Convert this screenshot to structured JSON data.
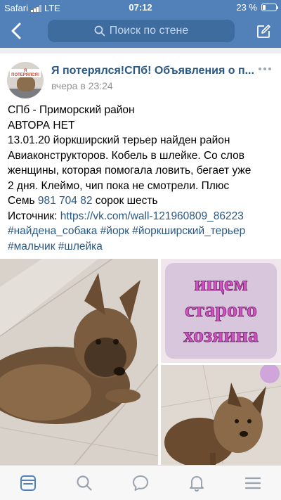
{
  "status_bar": {
    "carrier": "Safari",
    "network": "LTE",
    "time": "07:12",
    "battery": "23 %",
    "battery_level": 0.23
  },
  "navbar": {
    "search_placeholder": "Поиск по стене",
    "back_icon": "chevron-left-icon",
    "compose_icon": "compose-icon"
  },
  "post": {
    "group_name": "Я потерялся!СПб! Объявления о п...",
    "avatar_label": "Я ПОТЕРЯЛСЯ!",
    "time": "вчера в 23:24",
    "lines": {
      "l1": "СПб - Приморский район",
      "l2": "АВТОРА НЕТ",
      "l3": "13.01.20 йоркширский терьер найден район",
      "l4": "Авиаконструкторов. Кобель в шлейке. Со слов",
      "l5": "женщины, которая помогала ловить, бегает уже",
      "l6": "2 дня. Клеймо, чип пока не смотрели. Плюс",
      "l7_pre": "Семь ",
      "l7_phone": "981 704 82",
      "l7_post": " сорок шесть",
      "l8_pre": "Источник: ",
      "l8_link": "https://vk.com/wall-121960809_86223",
      "l9": "#найдена_собака #йорк #йоркширский_терьер",
      "l10": "#мальчик #шлейка"
    },
    "promo_image_text": {
      "line1": "ищем",
      "line2": "старого",
      "line3": "хозяина"
    }
  },
  "tabbar": {
    "items": [
      "news-icon",
      "search-icon",
      "messages-icon",
      "notifications-icon",
      "menu-icon"
    ],
    "active": "news-icon",
    "active_color": "#5181b8",
    "inactive_color": "#99a2ad"
  },
  "colors": {
    "accent": "#5181b8",
    "link": "#2a5885",
    "promo_text": "#d44fc4"
  }
}
